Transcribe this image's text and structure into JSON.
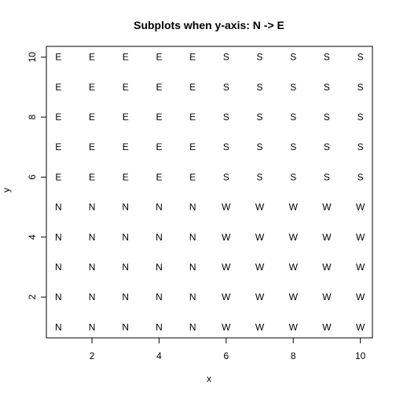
{
  "chart_data": {
    "type": "scatter",
    "title": "Subplots when y-axis: N -> E",
    "xlabel": "x",
    "ylabel": "y",
    "xlim": [
      0.64,
      10.36
    ],
    "ylim": [
      0.64,
      10.36
    ],
    "x_ticks": [
      2,
      4,
      6,
      8,
      10
    ],
    "y_ticks": [
      2,
      4,
      6,
      8,
      10
    ],
    "point_style": "letter labels",
    "grid": false,
    "legend": "none",
    "x": [
      1,
      2,
      3,
      4,
      5,
      6,
      7,
      8,
      9,
      10
    ],
    "y": [
      1,
      2,
      3,
      4,
      5,
      6,
      7,
      8,
      9,
      10
    ],
    "labels_by_y": {
      "1": [
        "N",
        "N",
        "N",
        "N",
        "N",
        "W",
        "W",
        "W",
        "W",
        "W"
      ],
      "2": [
        "N",
        "N",
        "N",
        "N",
        "N",
        "W",
        "W",
        "W",
        "W",
        "W"
      ],
      "3": [
        "N",
        "N",
        "N",
        "N",
        "N",
        "W",
        "W",
        "W",
        "W",
        "W"
      ],
      "4": [
        "N",
        "N",
        "N",
        "N",
        "N",
        "W",
        "W",
        "W",
        "W",
        "W"
      ],
      "5": [
        "N",
        "N",
        "N",
        "N",
        "N",
        "W",
        "W",
        "W",
        "W",
        "W"
      ],
      "6": [
        "E",
        "E",
        "E",
        "E",
        "E",
        "S",
        "S",
        "S",
        "S",
        "S"
      ],
      "7": [
        "E",
        "E",
        "E",
        "E",
        "E",
        "S",
        "S",
        "S",
        "S",
        "S"
      ],
      "8": [
        "E",
        "E",
        "E",
        "E",
        "E",
        "S",
        "S",
        "S",
        "S",
        "S"
      ],
      "9": [
        "E",
        "E",
        "E",
        "E",
        "E",
        "S",
        "S",
        "S",
        "S",
        "S"
      ],
      "10": [
        "E",
        "E",
        "E",
        "E",
        "E",
        "S",
        "S",
        "S",
        "S",
        "S"
      ]
    }
  }
}
